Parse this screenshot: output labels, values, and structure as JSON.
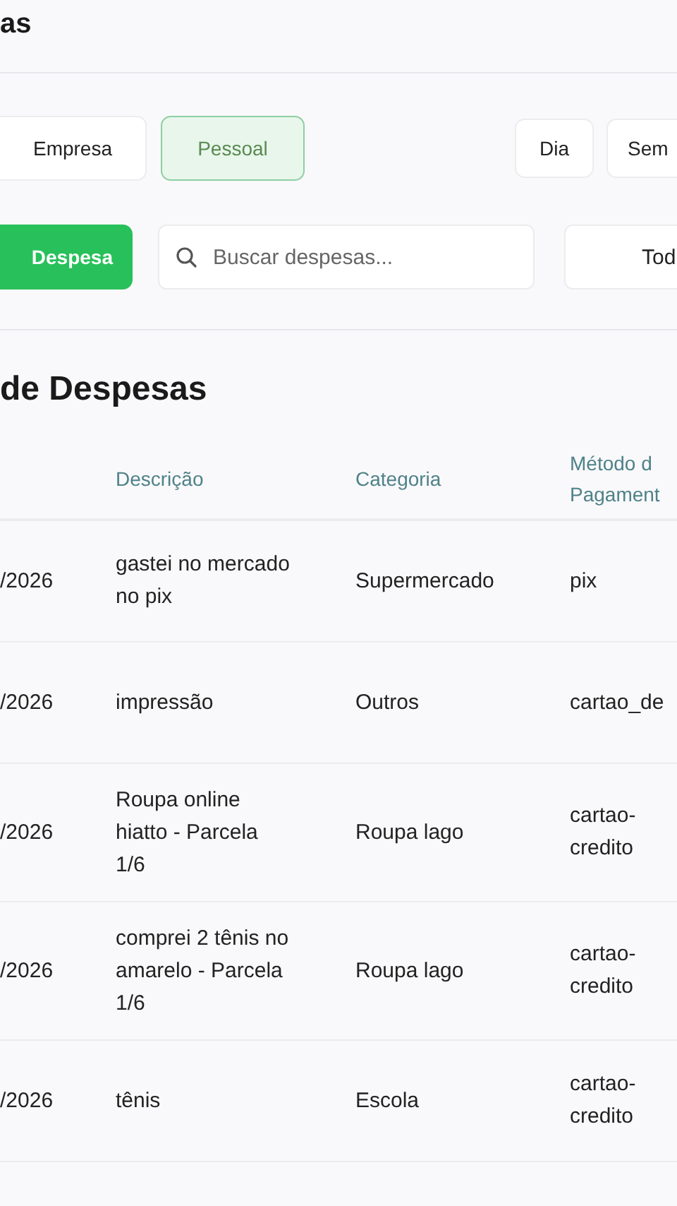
{
  "header": {
    "title": "as"
  },
  "scope_tabs": [
    {
      "label": "Empresa",
      "selected": false
    },
    {
      "label": "Pessoal",
      "selected": true
    }
  ],
  "period_tabs": [
    {
      "label": "Dia",
      "selected": false
    },
    {
      "label": "Sem",
      "selected": false
    }
  ],
  "add_button": "Despesa",
  "search": {
    "placeholder": "Buscar despesas..."
  },
  "filter_select": "Tod",
  "table": {
    "title": "de Despesas",
    "columns": [
      "Descrição",
      "Categoria",
      "Método d Pagament"
    ],
    "rows": [
      {
        "date": "/2026",
        "description": "gastei no mercado no pix",
        "category": "Supermercado",
        "method": "pix"
      },
      {
        "date": "/2026",
        "description": "impressão",
        "category": "Outros",
        "method": "cartao_de"
      },
      {
        "date": "/2026",
        "description": "Roupa online hiatto - Parcela 1/6",
        "category": "Roupa lago",
        "method": "cartao-credito"
      },
      {
        "date": "/2026",
        "description": "comprei 2 tênis no amarelo - Parcela 1/6",
        "category": "Roupa lago",
        "method": "cartao-credito"
      },
      {
        "date": "/2026",
        "description": "tênis",
        "category": "Escola",
        "method": "cartao-credito"
      }
    ]
  }
}
